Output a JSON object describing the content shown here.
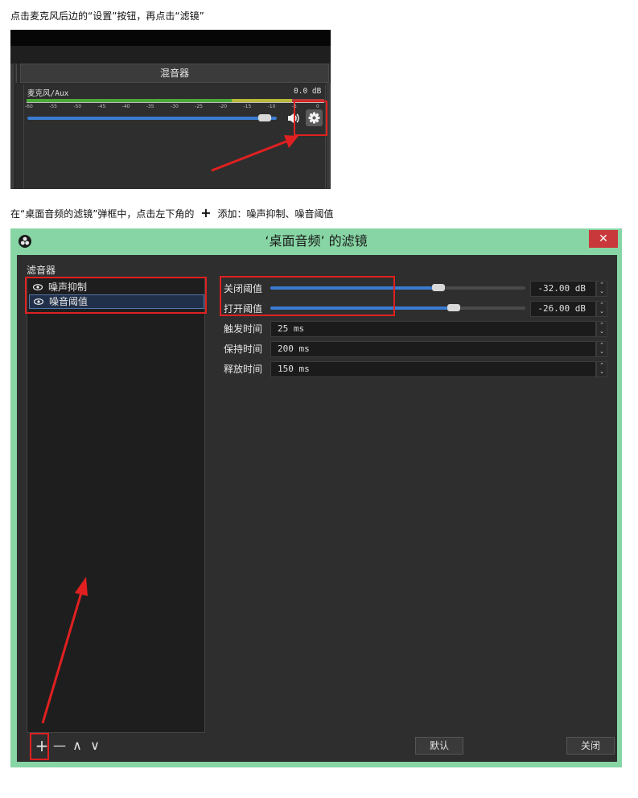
{
  "step1_text": "点击麦克风后边的“设置”按钮，再点击“滤镜”",
  "step2_text_before": "在“桌面音频的滤镜”弹框中，点击左下角的",
  "step2_plus": "+",
  "step2_text_after": "添加：噪声抑制、噪音阈值",
  "mixer": {
    "title": "混音器",
    "source_name": "麦克风/Aux",
    "db_value": "0.0 dB",
    "tick_labels": [
      "-60",
      "-55",
      "-50",
      "-45",
      "-40",
      "-35",
      "-30",
      "-25",
      "-20",
      "-15",
      "-10",
      "-5",
      "0"
    ],
    "volume_level": 0.95
  },
  "filter_window": {
    "title": "‘桌面音频’ 的滤镜",
    "close_glyph": "✕",
    "filters_label": "滤音器",
    "filters": [
      {
        "name": "噪声抑制",
        "selected": false
      },
      {
        "name": "噪音阈值",
        "selected": true
      }
    ],
    "props": {
      "close_threshold": {
        "label": "关闭阈值",
        "value": "-32.00 dB",
        "level": 0.66
      },
      "open_threshold": {
        "label": "打开阈值",
        "value": "-26.00 dB",
        "level": 0.72
      },
      "attack": {
        "label": "触发时间",
        "value": "25 ms"
      },
      "hold": {
        "label": "保持时间",
        "value": "200 ms"
      },
      "release": {
        "label": "释放时间",
        "value": "150 ms"
      }
    },
    "tools": {
      "add": "+",
      "remove": "—",
      "up": "∧",
      "down": "∨"
    },
    "default_button": "默认",
    "close_button": "关闭"
  },
  "colors": {
    "accent_blue": "#3b7bd0",
    "window_frame": "#87d5a4",
    "annotation_red": "#e02020"
  }
}
